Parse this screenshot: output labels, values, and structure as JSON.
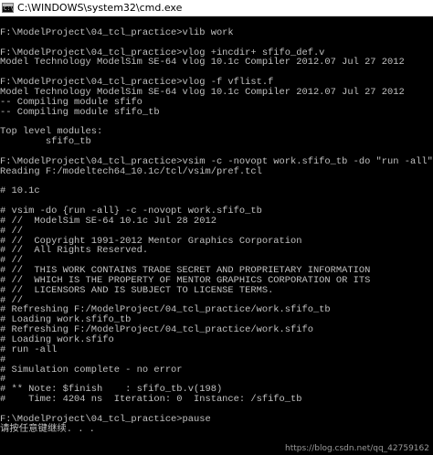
{
  "window": {
    "title": "C:\\WINDOWS\\system32\\cmd.exe",
    "icon_text": "C:\\"
  },
  "console": {
    "lines": [
      "",
      "F:\\ModelProject\\04_tcl_practice>vlib work",
      "",
      "F:\\ModelProject\\04_tcl_practice>vlog +incdir+ sfifo_def.v",
      "Model Technology ModelSim SE-64 vlog 10.1c Compiler 2012.07 Jul 27 2012",
      "",
      "F:\\ModelProject\\04_tcl_practice>vlog -f vflist.f",
      "Model Technology ModelSim SE-64 vlog 10.1c Compiler 2012.07 Jul 27 2012",
      "-- Compiling module sfifo",
      "-- Compiling module sfifo_tb",
      "",
      "Top level modules:",
      "        sfifo_tb",
      "",
      "F:\\ModelProject\\04_tcl_practice>vsim -c -novopt work.sfifo_tb -do \"run -all\"",
      "Reading F:/modeltech64_10.1c/tcl/vsim/pref.tcl",
      "",
      "# 10.1c",
      "",
      "# vsim -do {run -all} -c -novopt work.sfifo_tb",
      "# //  ModelSim SE-64 10.1c Jul 28 2012",
      "# //",
      "# //  Copyright 1991-2012 Mentor Graphics Corporation",
      "# //  All Rights Reserved.",
      "# //",
      "# //  THIS WORK CONTAINS TRADE SECRET AND PROPRIETARY INFORMATION",
      "# //  WHICH IS THE PROPERTY OF MENTOR GRAPHICS CORPORATION OR ITS",
      "# //  LICENSORS AND IS SUBJECT TO LICENSE TERMS.",
      "# //",
      "# Refreshing F:/ModelProject/04_tcl_practice/work.sfifo_tb",
      "# Loading work.sfifo_tb",
      "# Refreshing F:/ModelProject/04_tcl_practice/work.sfifo",
      "# Loading work.sfifo",
      "# run -all",
      "#",
      "# Simulation complete - no error",
      "#",
      "# ** Note: $finish    : sfifo_tb.v(198)",
      "#    Time: 4204 ns  Iteration: 0  Instance: /sfifo_tb",
      "",
      "F:\\ModelProject\\04_tcl_practice>pause",
      "请按任意键继续. . ."
    ]
  },
  "watermark": "https://blog.csdn.net/qq_42759162"
}
